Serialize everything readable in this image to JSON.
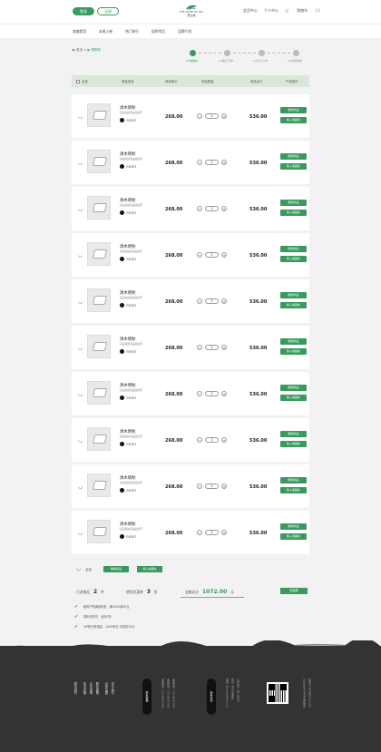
{
  "header": {
    "login_label": "登录",
    "register_label": "注册",
    "logo_en": "THE TASTE OF TEA",
    "logo_cn": "茶之味",
    "member_center": "会员中心",
    "personal_center": "个人中心",
    "cart_label": "购物车",
    "cart_count": "(0)"
  },
  "nav": [
    "商城首页",
    "本周上新",
    "热门排行",
    "促销专区",
    "品牌介绍"
  ],
  "breadcrumb": {
    "home": "首页",
    "sep": ">",
    "current": "购物车"
  },
  "steps": [
    {
      "label": "01购物车"
    },
    {
      "label": "02确认订单"
    },
    {
      "label": "03支付订单"
    },
    {
      "label": "04完成购物"
    }
  ],
  "table_headers": {
    "select": "全选",
    "info": "商品信息",
    "price": "商品单价",
    "qty": "商品数量",
    "subtotal": "商品合计",
    "ops": "产品操作"
  },
  "items": [
    {
      "name": "清木明秋",
      "desc": "商品描述商品描述字",
      "tag": "商品备注",
      "price": "268.00",
      "qty": "2",
      "subtotal": "536.00",
      "delete": "删除商品",
      "fav": "移入收藏夹"
    },
    {
      "name": "清木明秋",
      "desc": "商品描述商品描述字",
      "tag": "商品备注",
      "price": "268.00",
      "qty": "2",
      "subtotal": "536.00",
      "delete": "删除商品",
      "fav": "移入收藏夹"
    },
    {
      "name": "清木明秋",
      "desc": "商品描述商品描述字",
      "tag": "商品备注",
      "price": "268.00",
      "qty": "2",
      "subtotal": "536.00",
      "delete": "删除商品",
      "fav": "移入收藏夹"
    },
    {
      "name": "清木明秋",
      "desc": "商品描述商品描述字",
      "tag": "商品备注",
      "price": "268.00",
      "qty": "2",
      "subtotal": "536.00",
      "delete": "删除商品",
      "fav": "移入收藏夹"
    },
    {
      "name": "清木明秋",
      "desc": "商品描述商品描述字",
      "tag": "商品备注",
      "price": "268.00",
      "qty": "2",
      "subtotal": "536.00",
      "delete": "删除商品",
      "fav": "移入收藏夹"
    },
    {
      "name": "清木明秋",
      "desc": "商品描述商品描述字",
      "tag": "商品备注",
      "price": "268.00",
      "qty": "2",
      "subtotal": "536.00",
      "delete": "删除商品",
      "fav": "移入收藏夹"
    },
    {
      "name": "清木明秋",
      "desc": "商品描述商品描述字",
      "tag": "商品备注",
      "price": "268.00",
      "qty": "2",
      "subtotal": "536.00",
      "delete": "删除商品",
      "fav": "移入收藏夹"
    },
    {
      "name": "清木明秋",
      "desc": "商品描述商品描述字",
      "tag": "商品备注",
      "price": "268.00",
      "qty": "2",
      "subtotal": "536.00",
      "delete": "删除商品",
      "fav": "移入收藏夹"
    },
    {
      "name": "清木明秋",
      "desc": "商品描述商品描述字",
      "tag": "商品备注",
      "price": "268.00",
      "qty": "2",
      "subtotal": "536.00",
      "delete": "删除商品",
      "fav": "移入收藏夹"
    },
    {
      "name": "清木明秋",
      "desc": "商品描述商品描述字",
      "tag": "商品备注",
      "price": "268.00",
      "qty": "2",
      "subtotal": "536.00",
      "delete": "删除商品",
      "fav": "移入收藏夹"
    }
  ],
  "summary": {
    "select_all": "全选",
    "delete_selected": "删除商品",
    "move_fav": "移入收藏夹",
    "selected_label": "已选商品",
    "selected_count": "2",
    "selected_unit": "件",
    "coupon_label": "使用优惠券",
    "coupon_count": "3",
    "coupon_unit": "张",
    "total_label": "金额总计",
    "total_value": "1072.00",
    "total_unit": "元",
    "checkout": "去结算"
  },
  "perks": [
    "新用户购满减优惠　满1000减20元",
    "周年庆折扣　全场7折",
    "VIP积分抵现金　1000积分 可抵扣20元"
  ],
  "footer": {
    "col1": "联系我们",
    "col2": "常见问题",
    "col3": "企业采购",
    "col4": "联系客服",
    "col5": "合作加盟",
    "col6": "关于我们",
    "stamp1": "联系客服",
    "phone1": "客服热线：114-5654-2987",
    "phone2": "客服热线：114-5654-2987",
    "phone3": "客服热线：114-5654-2987",
    "stamp2": "商务合作",
    "biz1": "邮箱：business@tea.com",
    "biz2": "地址：北京市朝阳区",
    "biz3": "工作时间：周一至周五",
    "copy1": "Copyright 茶之味 版权所有",
    "copy2": "备案号 京ICP备0000000号"
  },
  "colors": {
    "accent": "#3a9a5e",
    "footer_bg": "#333333",
    "table_head_bg": "#d9e8d8"
  }
}
